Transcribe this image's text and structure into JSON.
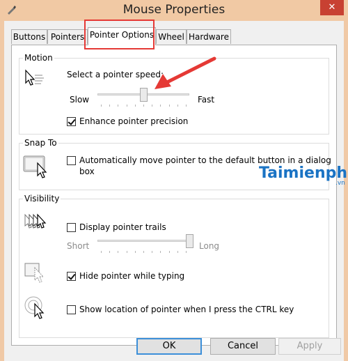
{
  "window": {
    "title": "Mouse Properties",
    "close_glyph": "✕"
  },
  "tabs": [
    {
      "label": "Buttons",
      "active": false
    },
    {
      "label": "Pointers",
      "active": false
    },
    {
      "label": "Pointer Options",
      "active": true
    },
    {
      "label": "Wheel",
      "active": false
    },
    {
      "label": "Hardware",
      "active": false
    }
  ],
  "motion": {
    "group_label": "Motion",
    "speed_label": "Select a pointer speed:",
    "slow_label": "Slow",
    "fast_label": "Fast",
    "speed_value": 0.5,
    "enhance_label": "Enhance pointer precision",
    "enhance_checked": true
  },
  "snap_to": {
    "group_label": "Snap To",
    "auto_move_label_line1": "Automatically move pointer to the default button in a dialog",
    "auto_move_label_line2": "box",
    "auto_move_checked": false
  },
  "visibility": {
    "group_label": "Visibility",
    "trails_label": "Display pointer trails",
    "trails_checked": false,
    "short_label": "Short",
    "long_label": "Long",
    "trails_value": 1.0,
    "hide_typing_label": "Hide pointer while typing",
    "hide_typing_checked": true,
    "show_location_label": "Show location of pointer when I press the CTRL key",
    "show_location_checked": false
  },
  "buttons": {
    "ok": "OK",
    "cancel": "Cancel",
    "apply": "Apply"
  },
  "watermark": {
    "brand": "Taimienphi",
    "suffix": ".vn"
  },
  "colors": {
    "annotation": "#e53935",
    "title_bar": "#f1c9a4",
    "accent": "#3c8fd9",
    "watermark": "#1a73c4"
  }
}
